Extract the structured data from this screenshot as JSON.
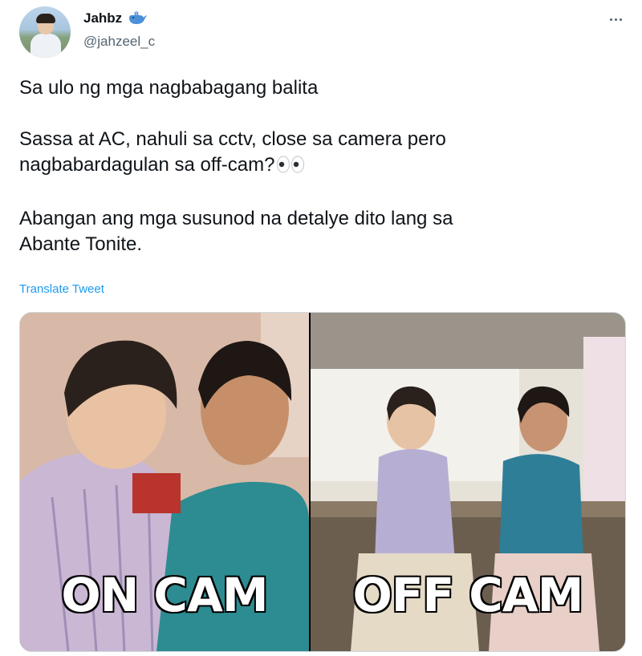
{
  "author": {
    "display_name": "Jahbz",
    "handle": "@jahzeel_c",
    "badge_icon": "whale-icon"
  },
  "tweet": {
    "line1": "Sa ulo ng mga nagbabagang balita",
    "line2": "Sassa at AC, nahuli sa cctv, close sa camera pero",
    "line3": "nagbabardagulan sa off-cam?",
    "line3_emoji": "eyes-emoji",
    "line4": "Abangan ang mga susunod na detalye dito lang sa",
    "line5": "Abante Tonite."
  },
  "translate_label": "Translate Tweet",
  "media": {
    "left_caption": "ON CAM",
    "right_caption": "OFF CAM"
  },
  "colors": {
    "link": "#1d9bf0",
    "secondary_text": "#536471",
    "border": "#cfd9de"
  }
}
